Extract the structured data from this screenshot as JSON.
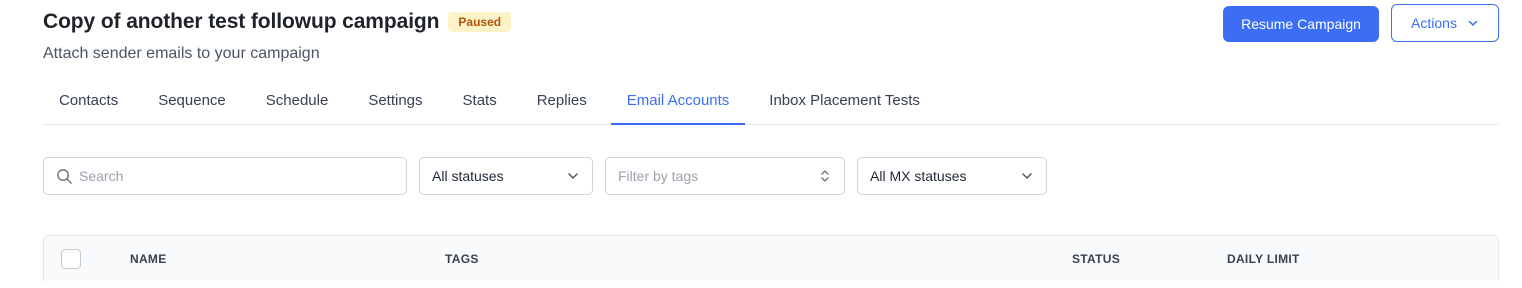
{
  "header": {
    "title": "Copy of another test followup campaign",
    "status_badge": "Paused",
    "subtitle": "Attach sender emails to your campaign",
    "resume_label": "Resume Campaign",
    "actions_label": "Actions"
  },
  "tabs": [
    {
      "label": "Contacts",
      "active": false
    },
    {
      "label": "Sequence",
      "active": false
    },
    {
      "label": "Schedule",
      "active": false
    },
    {
      "label": "Settings",
      "active": false
    },
    {
      "label": "Stats",
      "active": false
    },
    {
      "label": "Replies",
      "active": false
    },
    {
      "label": "Email Accounts",
      "active": true
    },
    {
      "label": "Inbox Placement Tests",
      "active": false
    }
  ],
  "filters": {
    "search_placeholder": "Search",
    "status_value": "All statuses",
    "tags_placeholder": "Filter by tags",
    "mx_value": "All MX statuses"
  },
  "table": {
    "columns": [
      "NAME",
      "TAGS",
      "STATUS",
      "DAILY LIMIT"
    ]
  },
  "icons": {
    "search": "search-icon",
    "chevron": "chevron-down-icon",
    "updown": "chevron-up-down-icon"
  },
  "colors": {
    "accent": "#3b6ef5",
    "badge_bg": "#fdf3c8",
    "badge_text": "#b45309"
  }
}
